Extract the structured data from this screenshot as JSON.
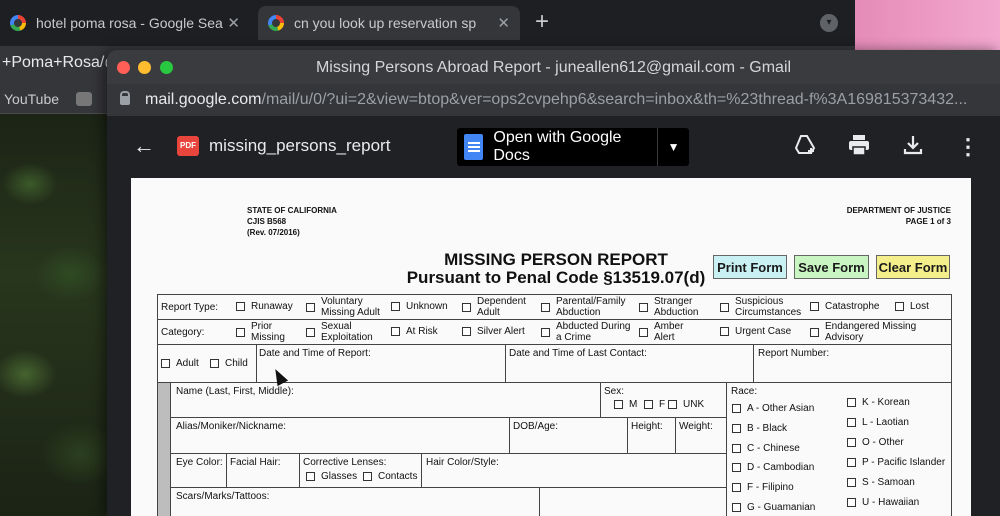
{
  "background_browser": {
    "tabs": [
      {
        "title": "hotel poma rosa - Google Sea"
      },
      {
        "title": "cn you look up reservation sp"
      }
    ],
    "new_tab_label": "+",
    "url_fragment": "+Poma+Rosa/@",
    "bookmark": "YouTube"
  },
  "window": {
    "title": "Missing Persons Abroad Report - juneallen612@gmail.com - Gmail",
    "address_host": "mail.google.com",
    "address_path": "/mail/u/0/?ui=2&view=btop&ver=ops2cvpehp6&search=inbox&th=%23thread-f%3A169815373432..."
  },
  "viewer": {
    "file_badge": "PDF",
    "file_name": "missing_persons_report",
    "open_with_label": "Open with Google Docs",
    "icons": [
      "back-arrow-icon",
      "add-to-drive-icon",
      "print-icon",
      "download-icon",
      "more-vert-icon"
    ]
  },
  "form": {
    "header_left": [
      "STATE OF CALIFORNIA",
      "CJIS B568",
      "(Rev. 07/2016)"
    ],
    "header_right": [
      "DEPARTMENT OF JUSTICE",
      "PAGE 1 of 3"
    ],
    "title": "MISSING PERSON REPORT",
    "subtitle": "Pursuant to Penal Code §13519.07(d)",
    "buttons": {
      "print": "Print Form",
      "save": "Save Form",
      "clear": "Clear Form"
    },
    "report_type_label": "Report Type:",
    "report_types": [
      "Runaway",
      "Voluntary Missing Adult",
      "Unknown",
      "Dependent Adult",
      "Parental/Family Abduction",
      "Stranger Abduction",
      "Suspicious Circumstances",
      "Catastrophe",
      "Lost"
    ],
    "category_label": "Category:",
    "categories": [
      "Prior Missing",
      "Sexual Exploitation",
      "At Risk",
      "Silver Alert",
      "Abducted During a Crime",
      "Amber Alert",
      "Urgent Case",
      "Endangered Missing Advisory"
    ],
    "age_options": [
      "Adult",
      "Child"
    ],
    "date_report_label": "Date and Time of Report:",
    "date_contact_label": "Date and Time of Last Contact:",
    "report_number_label": "Report Number:",
    "name_label": "Name (Last, First, Middle):",
    "sex_label": "Sex:",
    "sex_options": [
      "M",
      "F",
      "UNK"
    ],
    "race_label": "Race:",
    "race_left": [
      "A - Other Asian",
      "B - Black",
      "C - Chinese",
      "D - Cambodian",
      "F - Filipino",
      "G - Guamanian"
    ],
    "race_right": [
      "K - Korean",
      "L - Laotian",
      "O - Other",
      "P - Pacific Islander",
      "S - Samoan",
      "U - Hawaiian"
    ],
    "alias_label": "Alias/Moniker/Nickname:",
    "dob_label": "DOB/Age:",
    "height_label": "Height:",
    "weight_label": "Weight:",
    "eye_label": "Eye Color:",
    "facial_hair_label": "Facial Hair:",
    "lenses_label": "Corrective Lenses:",
    "lenses_options": [
      "Glasses",
      "Contacts"
    ],
    "hair_label": "Hair Color/Style:",
    "scars_label": "Scars/Marks/Tattoos:"
  },
  "colors": {
    "print_btn": "#c9f0f2",
    "save_btn": "#c8f5c2",
    "clear_btn": "#f4ef8a",
    "pdf_badge": "#e8453c",
    "docs_blue": "#4285f4"
  }
}
